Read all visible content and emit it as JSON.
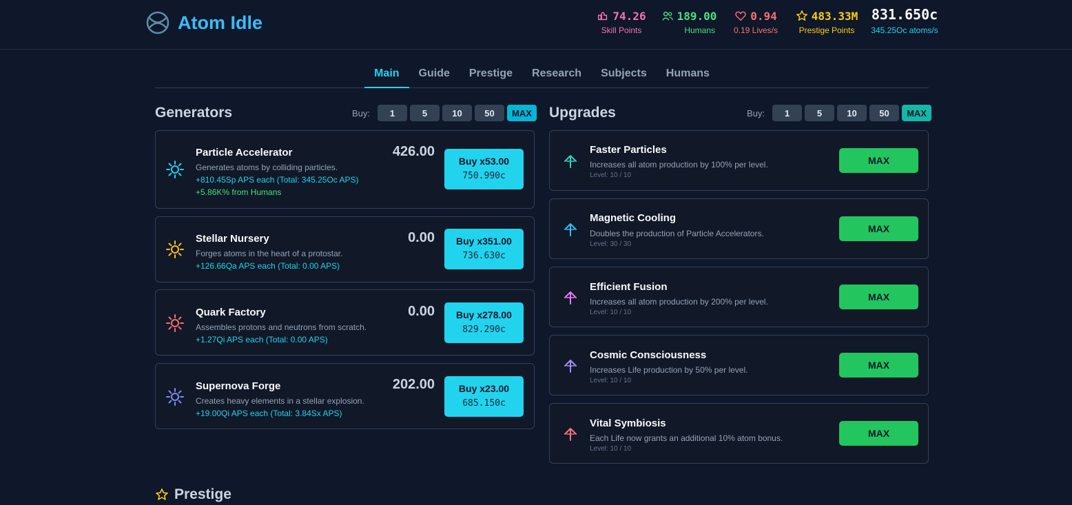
{
  "app": {
    "title": "Atom Idle"
  },
  "stats": {
    "skill_points": {
      "value": "74.26",
      "label": "Skill Points"
    },
    "humans": {
      "value": "189.00",
      "label": "Humans"
    },
    "lives": {
      "value": "0.94",
      "label": "0.19 Lives/s"
    },
    "prestige": {
      "value": "483.33M",
      "label": "Prestige Points"
    },
    "atoms": {
      "value": "831.650c",
      "label": "345.25Oc atoms/s"
    }
  },
  "tabs": [
    "Main",
    "Guide",
    "Prestige",
    "Research",
    "Subjects",
    "Humans"
  ],
  "generators": {
    "title": "Generators",
    "buy_label": "Buy:",
    "buy_options": [
      "1",
      "5",
      "10",
      "50",
      "MAX"
    ],
    "items": [
      {
        "name": "Particle Accelerator",
        "desc": "Generates atoms by colliding particles.",
        "aps": "+810.45Sp APS each (Total: 345.25Oc APS)",
        "bonus": "+5.86K% from Humans",
        "count": "426.00",
        "buy": "Buy x53.00",
        "cost": "750.990c"
      },
      {
        "name": "Stellar Nursery",
        "desc": "Forges atoms in the heart of a protostar.",
        "aps": "+126.66Qa APS each (Total: 0.00 APS)",
        "count": "0.00",
        "buy": "Buy x351.00",
        "cost": "736.630c"
      },
      {
        "name": "Quark Factory",
        "desc": "Assembles protons and neutrons from scratch.",
        "aps": "+1.27Qi APS each (Total: 0.00 APS)",
        "count": "0.00",
        "buy": "Buy x278.00",
        "cost": "829.290c"
      },
      {
        "name": "Supernova Forge",
        "desc": "Creates heavy elements in a stellar explosion.",
        "aps": "+19.00Qi APS each (Total: 3.84Sx APS)",
        "count": "202.00",
        "buy": "Buy x23.00",
        "cost": "685.150c"
      }
    ]
  },
  "upgrades": {
    "title": "Upgrades",
    "buy_label": "Buy:",
    "buy_options": [
      "1",
      "5",
      "10",
      "50",
      "MAX"
    ],
    "items": [
      {
        "name": "Faster Particles",
        "desc": "Increases all atom production by 100% per level.",
        "level": "Level: 10 / 10",
        "button": "MAX"
      },
      {
        "name": "Magnetic Cooling",
        "desc": "Doubles the production of Particle Accelerators.",
        "level": "Level: 30 / 30",
        "button": "MAX"
      },
      {
        "name": "Efficient Fusion",
        "desc": "Increases all atom production by 200% per level.",
        "level": "Level: 10 / 10",
        "button": "MAX"
      },
      {
        "name": "Cosmic Consciousness",
        "desc": "Increases Life production by 50% per level.",
        "level": "Level: 10 / 10",
        "button": "MAX"
      },
      {
        "name": "Vital Symbiosis",
        "desc": "Each Life now grants an additional 10% atom bonus.",
        "level": "Level: 10 / 10",
        "button": "MAX"
      }
    ]
  },
  "prestige_section": {
    "title": "Prestige"
  },
  "colors": {
    "background": "#0f172a",
    "accent": "#22d3ee",
    "upgrade_button": "#22c55e",
    "generator_icons": [
      "#22d3ee",
      "#fbbf24",
      "#f87171",
      "#818cf8"
    ],
    "upgrade_icons": [
      "#2dd4bf",
      "#38bdf8",
      "#e879f9",
      "#a78bfa",
      "#fb7185"
    ]
  }
}
